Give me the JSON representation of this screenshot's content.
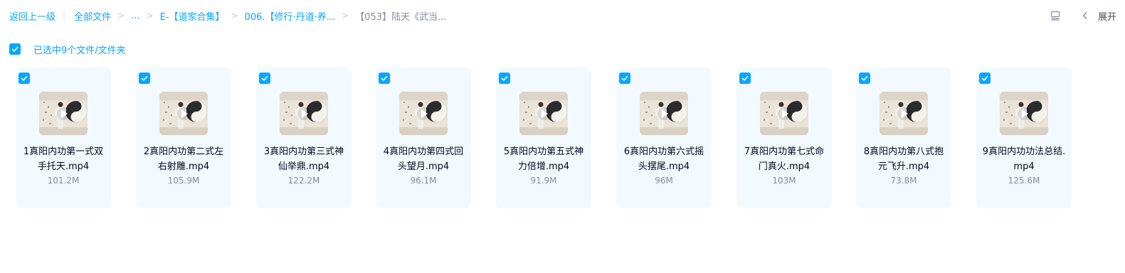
{
  "breadcrumb": {
    "back": "返回上一级",
    "items": [
      "全部文件",
      "...",
      "E-【道家合集】",
      "006.【修行·丹道·养..."
    ],
    "current": "【053】陆天《武当..."
  },
  "toolbar": {
    "expand_label": "展开",
    "icons": [
      "list-view-icon",
      "chevron-left-icon"
    ]
  },
  "selection": {
    "label": "已选中9个文件/文件夹"
  },
  "files": [
    {
      "name": "1真阳内功第一式双手托天.mp4",
      "size": "101.2M"
    },
    {
      "name": "2真阳内功第二式左右射雕.mp4",
      "size": "105.9M"
    },
    {
      "name": "3真阳内功第三式神仙举鼎.mp4",
      "size": "122.2M"
    },
    {
      "name": "4真阳内功第四式回头望月.mp4",
      "size": "96.1M"
    },
    {
      "name": "5真阳内功第五式神力倍增.mp4",
      "size": "91.9M"
    },
    {
      "name": "6真阳内功第六式摇头摆尾.mp4",
      "size": "96M"
    },
    {
      "name": "7真阳内功第七式命门真火.mp4",
      "size": "103M"
    },
    {
      "name": "8真阳内功第八式抱元飞升.mp4",
      "size": "73.8M"
    },
    {
      "name": "9真阳内功功法总结.mp4",
      "size": "125.6M"
    }
  ],
  "colors": {
    "accent": "#06a7ff",
    "card_bg": "#f2faff",
    "muted_text": "#878c9c"
  }
}
